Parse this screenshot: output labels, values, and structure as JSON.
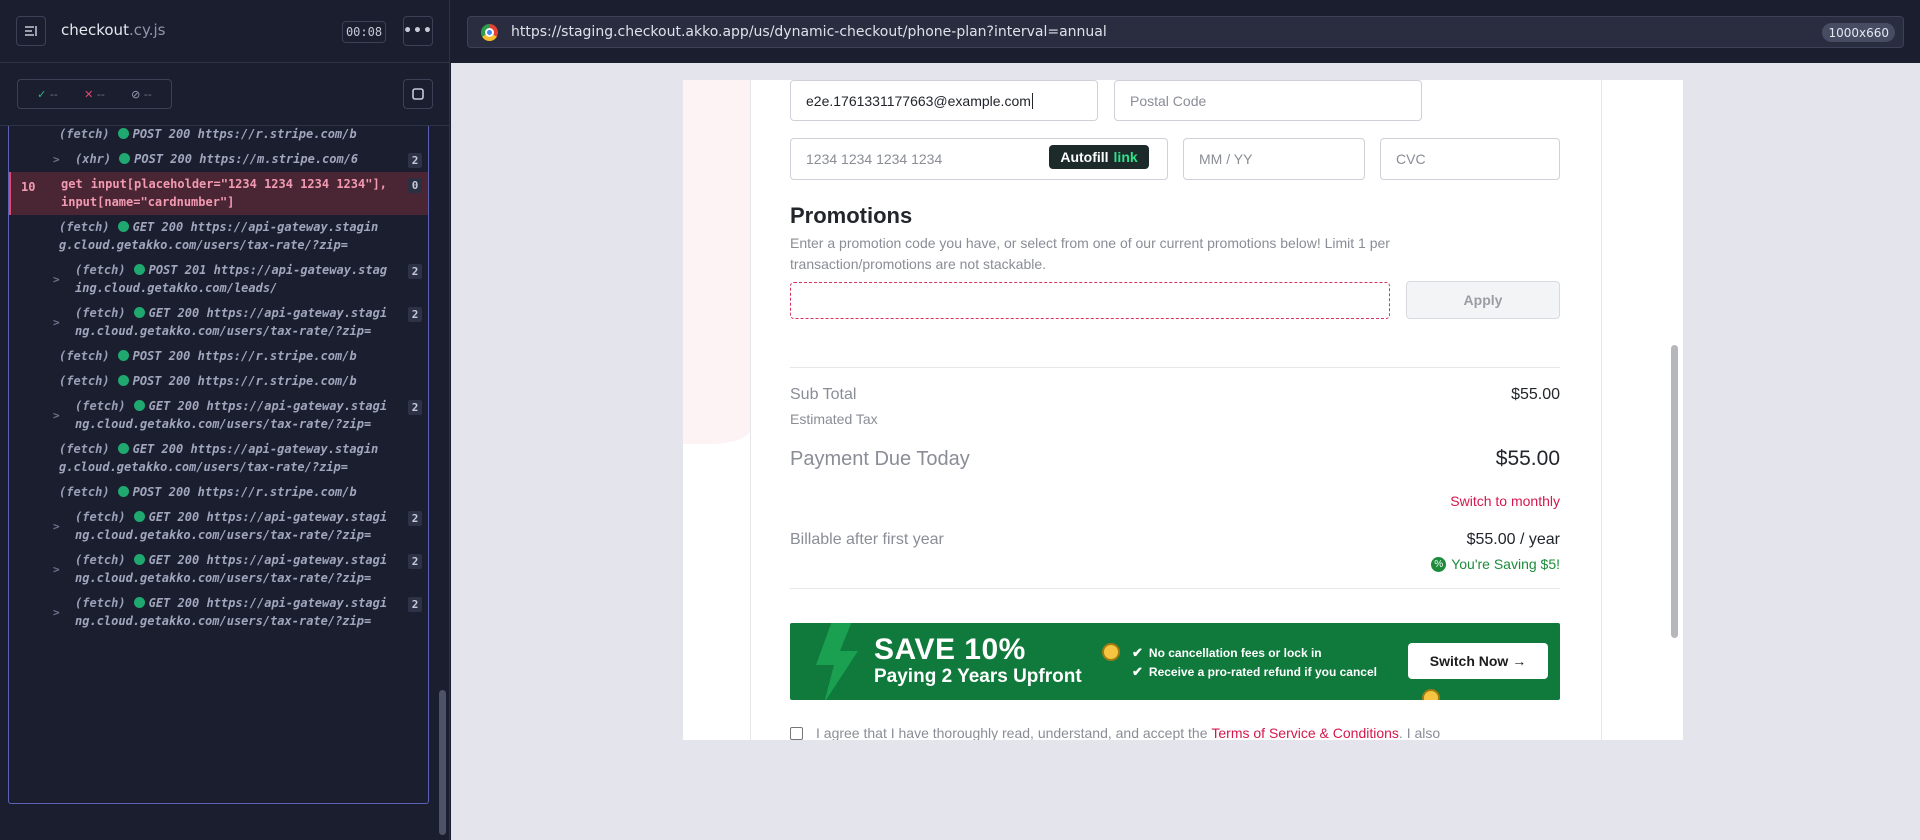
{
  "runner": {
    "spec_name": "checkout",
    "spec_ext": ".cy.js",
    "timer": "00:08",
    "stats": {
      "passed": "--",
      "failed": "--",
      "pending": "--"
    },
    "commands": [
      {
        "type": "fetch",
        "method": "POST",
        "status": "200",
        "url": "https://r.stripe.com/b",
        "count": "",
        "indent": false,
        "caret": false
      },
      {
        "type": "xhr",
        "method": "POST",
        "status": "200",
        "url": "https://m.stripe.com/6",
        "count": "2",
        "indent": true,
        "caret": true
      },
      {
        "active": true,
        "num": "10",
        "name": "get",
        "text": "input[placeholder=\"1234 1234 1234 1234\"], input[name=\"cardnumber\"]",
        "count": "0"
      },
      {
        "type": "fetch",
        "method": "GET",
        "status": "200",
        "url": "https://api-gateway.staging.cloud.getakko.com/users/tax-rate/?zip=",
        "count": "",
        "indent": false,
        "caret": false
      },
      {
        "type": "fetch",
        "method": "POST",
        "status": "201",
        "url": "https://api-gateway.staging.cloud.getakko.com/leads/",
        "count": "2",
        "indent": true,
        "caret": true
      },
      {
        "type": "fetch",
        "method": "GET",
        "status": "200",
        "url": "https://api-gateway.staging.cloud.getakko.com/users/tax-rate/?zip=",
        "count": "2",
        "indent": true,
        "caret": true
      },
      {
        "type": "fetch",
        "method": "POST",
        "status": "200",
        "url": "https://r.stripe.com/b",
        "count": "",
        "indent": false,
        "caret": false
      },
      {
        "type": "fetch",
        "method": "POST",
        "status": "200",
        "url": "https://r.stripe.com/b",
        "count": "",
        "indent": false,
        "caret": false
      },
      {
        "type": "fetch",
        "method": "GET",
        "status": "200",
        "url": "https://api-gateway.staging.cloud.getakko.com/users/tax-rate/?zip=",
        "count": "2",
        "indent": true,
        "caret": true
      },
      {
        "type": "fetch",
        "method": "GET",
        "status": "200",
        "url": "https://api-gateway.staging.cloud.getakko.com/users/tax-rate/?zip=",
        "count": "",
        "indent": false,
        "caret": false
      },
      {
        "type": "fetch",
        "method": "POST",
        "status": "200",
        "url": "https://r.stripe.com/b",
        "count": "",
        "indent": false,
        "caret": false
      },
      {
        "type": "fetch",
        "method": "GET",
        "status": "200",
        "url": "https://api-gateway.staging.cloud.getakko.com/users/tax-rate/?zip=",
        "count": "2",
        "indent": true,
        "caret": true
      },
      {
        "type": "fetch",
        "method": "GET",
        "status": "200",
        "url": "https://api-gateway.staging.cloud.getakko.com/users/tax-rate/?zip=",
        "count": "2",
        "indent": true,
        "caret": true
      },
      {
        "type": "fetch",
        "method": "GET",
        "status": "200",
        "url": "https://api-gateway.staging.cloud.getakko.com/users/tax-rate/?zip=",
        "count": "2",
        "indent": true,
        "caret": true
      }
    ]
  },
  "browser": {
    "url": "https://staging.checkout.akko.app/us/dynamic-checkout/phone-plan?interval=annual",
    "viewport": "1000x660"
  },
  "form": {
    "email_value": "e2e.1761331177663@example.com",
    "postal_placeholder": "Postal Code",
    "card_placeholder": "1234 1234 1234 1234",
    "autofill_label": "Autofill",
    "autofill_link": "link",
    "expiry_placeholder": "MM / YY",
    "cvc_placeholder": "CVC"
  },
  "promotions": {
    "heading": "Promotions",
    "description": "Enter a promotion code you have, or select from one of our current promotions below! Limit 1 per transaction/promotions are not stackable.",
    "input_value": "",
    "apply_label": "Apply"
  },
  "summary": {
    "subtotal_label": "Sub Total",
    "subtotal_value": "$55.00",
    "tax_label": "Estimated Tax",
    "due_label": "Payment Due Today",
    "due_value": "$55.00",
    "switch_monthly": "Switch to monthly",
    "billable_label": "Billable after first year",
    "billable_value": "$55.00 / year",
    "saving_text": "You're Saving $5!"
  },
  "banner": {
    "headline": "SAVE 10%",
    "subline": "Paying 2 Years Upfront",
    "benefits": [
      "No cancellation fees or lock in",
      "Receive a pro-rated refund if you cancel"
    ],
    "cta": "Switch Now →"
  },
  "agreement": {
    "prefix": "I agree that I have thoroughly read, understand, and accept the ",
    "link": "Terms of Service & Conditions",
    "suffix": ". I also"
  },
  "colors": {
    "accent": "#d4174d",
    "banner_green": "#0f7a3c",
    "runner_bg": "#1b1e2e"
  }
}
